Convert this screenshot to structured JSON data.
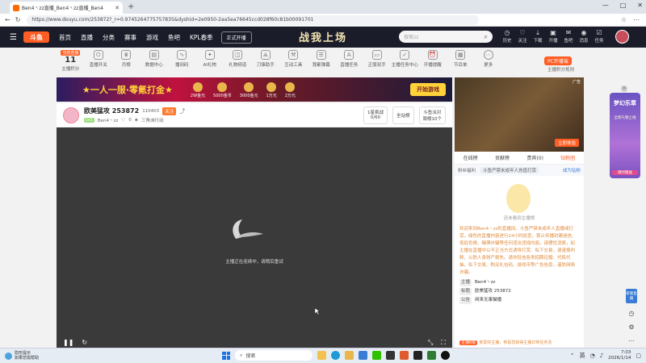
{
  "browser": {
    "tab_title": "Ben4丶zz直播_Ben4丶zz直播_Ben4",
    "url": "https://www.douyu.com/253872?_r=0.9745264775757835&dyshid=2e0950-2aa5ea76645ccd028f60c81b00091701",
    "window_controls": [
      "—",
      "□",
      "✕"
    ]
  },
  "header": {
    "logo": "斗鱼",
    "nav": [
      "首页",
      "直播",
      "分类",
      "赛事",
      "游戏",
      "鱼吧",
      "KPL春季"
    ],
    "promo": "正式开播",
    "banner_text": "战我上场",
    "search_placeholder": "搜索zz",
    "icons": [
      {
        "label": "历史",
        "icon": "history-icon"
      },
      {
        "label": "关注",
        "icon": "heart-icon"
      },
      {
        "label": "下载",
        "icon": "download-icon"
      },
      {
        "label": "开播",
        "icon": "camera-icon"
      },
      {
        "label": "鱼吧",
        "icon": "message-icon"
      },
      {
        "label": "消息",
        "icon": "bell-icon"
      },
      {
        "label": "任务",
        "icon": "task-icon"
      }
    ]
  },
  "toolbar": {
    "first": {
      "badge": "当前直播",
      "count": "11",
      "label": "主播积分"
    },
    "items": [
      "直播开关",
      "月榜",
      "数据中心",
      "播间码",
      "AI礼物",
      "礼物频道",
      "刀锋助手",
      "互动工具",
      "我都弹幕",
      "直播任务",
      "正版双手",
      "主播任务中心",
      "开播提醒",
      "节目单",
      "更多"
    ],
    "pc_button": "PC开播端",
    "pc_sub": "主播积分规则"
  },
  "ad_banner": {
    "title": "★一人一服·零氪打金★",
    "ranks": [
      "2W金元",
      "5000金币",
      "3000金元",
      "1万元",
      "2万元"
    ],
    "cta": "开始游戏"
  },
  "streamer": {
    "title": "欧美猛攻 253872",
    "room_id": "110403",
    "follow": "关注",
    "level": "LV1",
    "name": "Ben4丶zz",
    "likes": "0",
    "category": "三角洲行动",
    "btn1_top": "1星挑战",
    "btn1_bottom": "0/60",
    "btn2": "全站榜",
    "btn3_top": "斗鱼派对",
    "btn3_bottom": "周榜10个"
  },
  "video": {
    "message": "主播正在连续中，请稍后重试"
  },
  "side": {
    "ad_tag": "广告",
    "ad_cta": "立即体验",
    "tabs": [
      "在线榜",
      "贡献榜",
      "贵宾(0)",
      "钻粉团"
    ],
    "row_left": "粉丝福利",
    "row_pill": "斗鱼严禁未成年人充值打赏",
    "row_right": "成为钻粉",
    "mascot_caption": "还未看到主播榜",
    "welcome": "欢迎来到Ben4丶zz的直播间。斗鱼严禁未成年人直播或打赏，绿色的直播内容进行24小时巡查，禁止传播封建迷信、低俗色情、赌博诈骗等任何违法违规内容。请理性消费，如主播在直播中以不正当方式诱导打赏、私下交易，请谨慎判断，以防人身财产损失。请勿轻信各类招聘征婚、代练代抽、私下交易、购买礼包码、游戏币等广告信息，谨防网络诈骗。",
    "kv": [
      {
        "k": "主播",
        "v": "Ben4丶zz"
      },
      {
        "k": "标题",
        "v": "欧美猛攻 253872"
      },
      {
        "k": "公告",
        "v": "闲来无事猫播"
      }
    ],
    "bottom_badge": "主播6级",
    "bottom_text": "亲爱的主播，恭喜您获得主播日常任务活"
  },
  "float_ad": {
    "t1": "梦幻乐章",
    "t2": "全新礼物上线",
    "t3": "限时赠送"
  },
  "rail": {
    "badge": "新版直播"
  },
  "taskbar": {
    "weather_title": "隐形提示",
    "weather_sub": "如果您需帮助",
    "search": "搜索",
    "time": "7:03",
    "date": "2026/1/14",
    "lang": "英"
  },
  "colors": {
    "accent": "#ff5d23",
    "nav_bg": "#1a1c2a",
    "video_bg": "#3a3a3a"
  }
}
